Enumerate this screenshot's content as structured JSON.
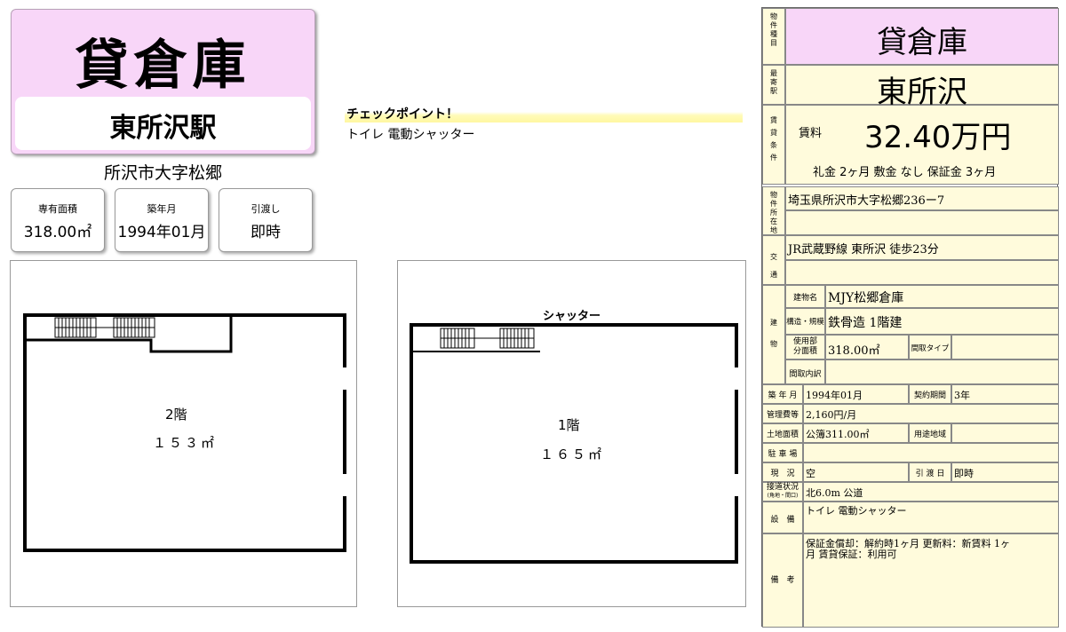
{
  "header": {
    "type": "貸倉庫",
    "station": "東所沢駅",
    "address": "所沢市大字松郷"
  },
  "info_cards": [
    {
      "label": "専有面積",
      "value": "318.00㎡"
    },
    {
      "label": "築年月",
      "value": "1994年01月"
    },
    {
      "label": "引渡し",
      "value": "即時"
    }
  ],
  "checkpoint": {
    "title": "チェックポイント！",
    "text": "トイレ 電動シャッター"
  },
  "floor2": {
    "name": "2階",
    "area": "１５３㎡"
  },
  "floor1": {
    "name": "1階",
    "area": "１６５㎡",
    "shutter": "シャッター"
  },
  "table": {
    "type_label": "物件種目",
    "type_value": "貸倉庫",
    "station_label": "最寄駅",
    "station_value": "東所沢",
    "terms_label": "賃貸条件",
    "rent_label": "賃料",
    "rent_value": "32.40万円",
    "deposits": "礼金 2ヶ月  敷金 なし  保証金 3ヶ月",
    "address_label": "物件所在地",
    "address_value": "埼玉県所沢市大字松郷236ー7",
    "transport_label": "交通",
    "transport_value": "JR武蔵野線 東所沢 徒歩23分",
    "building_label": "建物",
    "building_name_label": "建物名",
    "building_name_value": "MJY松郷倉庫",
    "structure_label": "構造・規模",
    "structure_value": "鉄骨造 1階建",
    "usage_area_label": "使用部分面積",
    "usage_area_value": "318.00㎡",
    "layout_type_label": "間取タイプ",
    "layout_type_value": "",
    "layout_detail_label": "間取内訳",
    "built_label": "築 年 月",
    "built_value": "1994年01月",
    "contract_label": "契約期間",
    "contract_value": "3年",
    "mgmt_label": "管理費等",
    "mgmt_value": "2,160円/月",
    "land_label": "土地面積",
    "land_value": "公簿311.00㎡",
    "zoning_label": "用途地域",
    "parking_label": "駐 車 場",
    "status_label": "現　況",
    "status_value": "空",
    "handover_label": "引 渡 日",
    "handover_value": "即時",
    "road_label": "接道状況",
    "road_sub_label": "(角地・間口)",
    "road_value": "北6.0m 公道",
    "equipment_label": "設　備",
    "equipment_value": "トイレ 電動シャッター",
    "remarks_label": "備　考",
    "remarks_line1": "保証金償却：解約時1ヶ月  更新料：新賃料 1ヶ",
    "remarks_line2": "月  賃貸保証：利用可"
  }
}
